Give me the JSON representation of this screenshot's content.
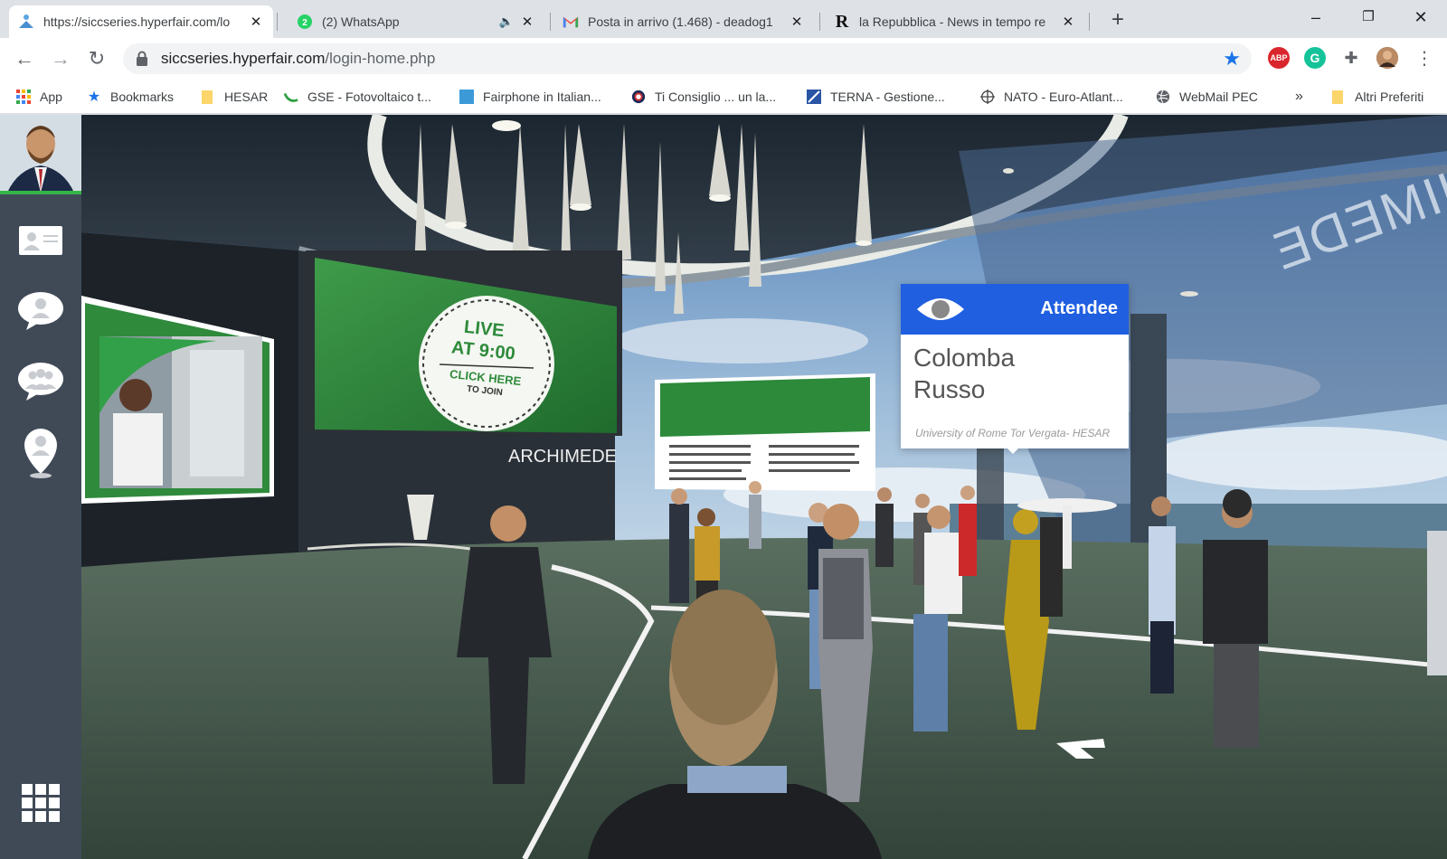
{
  "browser": {
    "tabs": [
      {
        "title": "https://siccseries.hyperfair.com/lo",
        "active": true,
        "favicon": "hyperfair-icon"
      },
      {
        "title": "(2) WhatsApp",
        "active": false,
        "favicon": "whatsapp-icon",
        "badge": "2",
        "muted": true
      },
      {
        "title": "Posta in arrivo (1.468) - deadog1",
        "active": false,
        "favicon": "gmail-icon"
      },
      {
        "title": "la Repubblica - News in tempo re",
        "active": false,
        "favicon": "repubblica-icon"
      }
    ],
    "url_domain": "siccseries.hyperfair.com",
    "url_path": "/login-home.php",
    "bookmarks": [
      {
        "label": "App",
        "icon": "apps-grid-icon"
      },
      {
        "label": "Bookmarks",
        "icon": "star-icon"
      },
      {
        "label": "HESAR",
        "icon": "folder-icon"
      },
      {
        "label": "GSE - Fotovoltaico t...",
        "icon": "gse-icon"
      },
      {
        "label": "Fairphone in Italian...",
        "icon": "fairphone-icon"
      },
      {
        "label": "Ti Consiglio ... un la...",
        "icon": "ticonsiglio-icon"
      },
      {
        "label": "TERNA - Gestione...",
        "icon": "terna-icon"
      },
      {
        "label": "NATO - Euro-Atlant...",
        "icon": "nato-icon"
      },
      {
        "label": "WebMail PEC",
        "icon": "globe-icon"
      },
      {
        "label": "»",
        "icon": ""
      },
      {
        "label": "Altri Preferiti",
        "icon": "folder-icon"
      }
    ],
    "extensions": [
      "ABP"
    ]
  },
  "scene": {
    "live_badge_line1": "LIVE",
    "live_badge_line2": "AT 9:00",
    "live_badge_line3": "CLICK HERE",
    "live_badge_line4": "TO JOIN",
    "booth_name": "ARCHIMEDE",
    "wall_sign": "HIMEDE"
  },
  "attendee_card": {
    "role": "Attendee",
    "first_name": "Colomba",
    "last_name": "Russo",
    "organization": "University of  Rome Tor Vergata- HESAR"
  },
  "colors": {
    "sidebar": "#404a57",
    "card_header": "#1f5fe0",
    "screen_green": "#2e8a3a"
  }
}
